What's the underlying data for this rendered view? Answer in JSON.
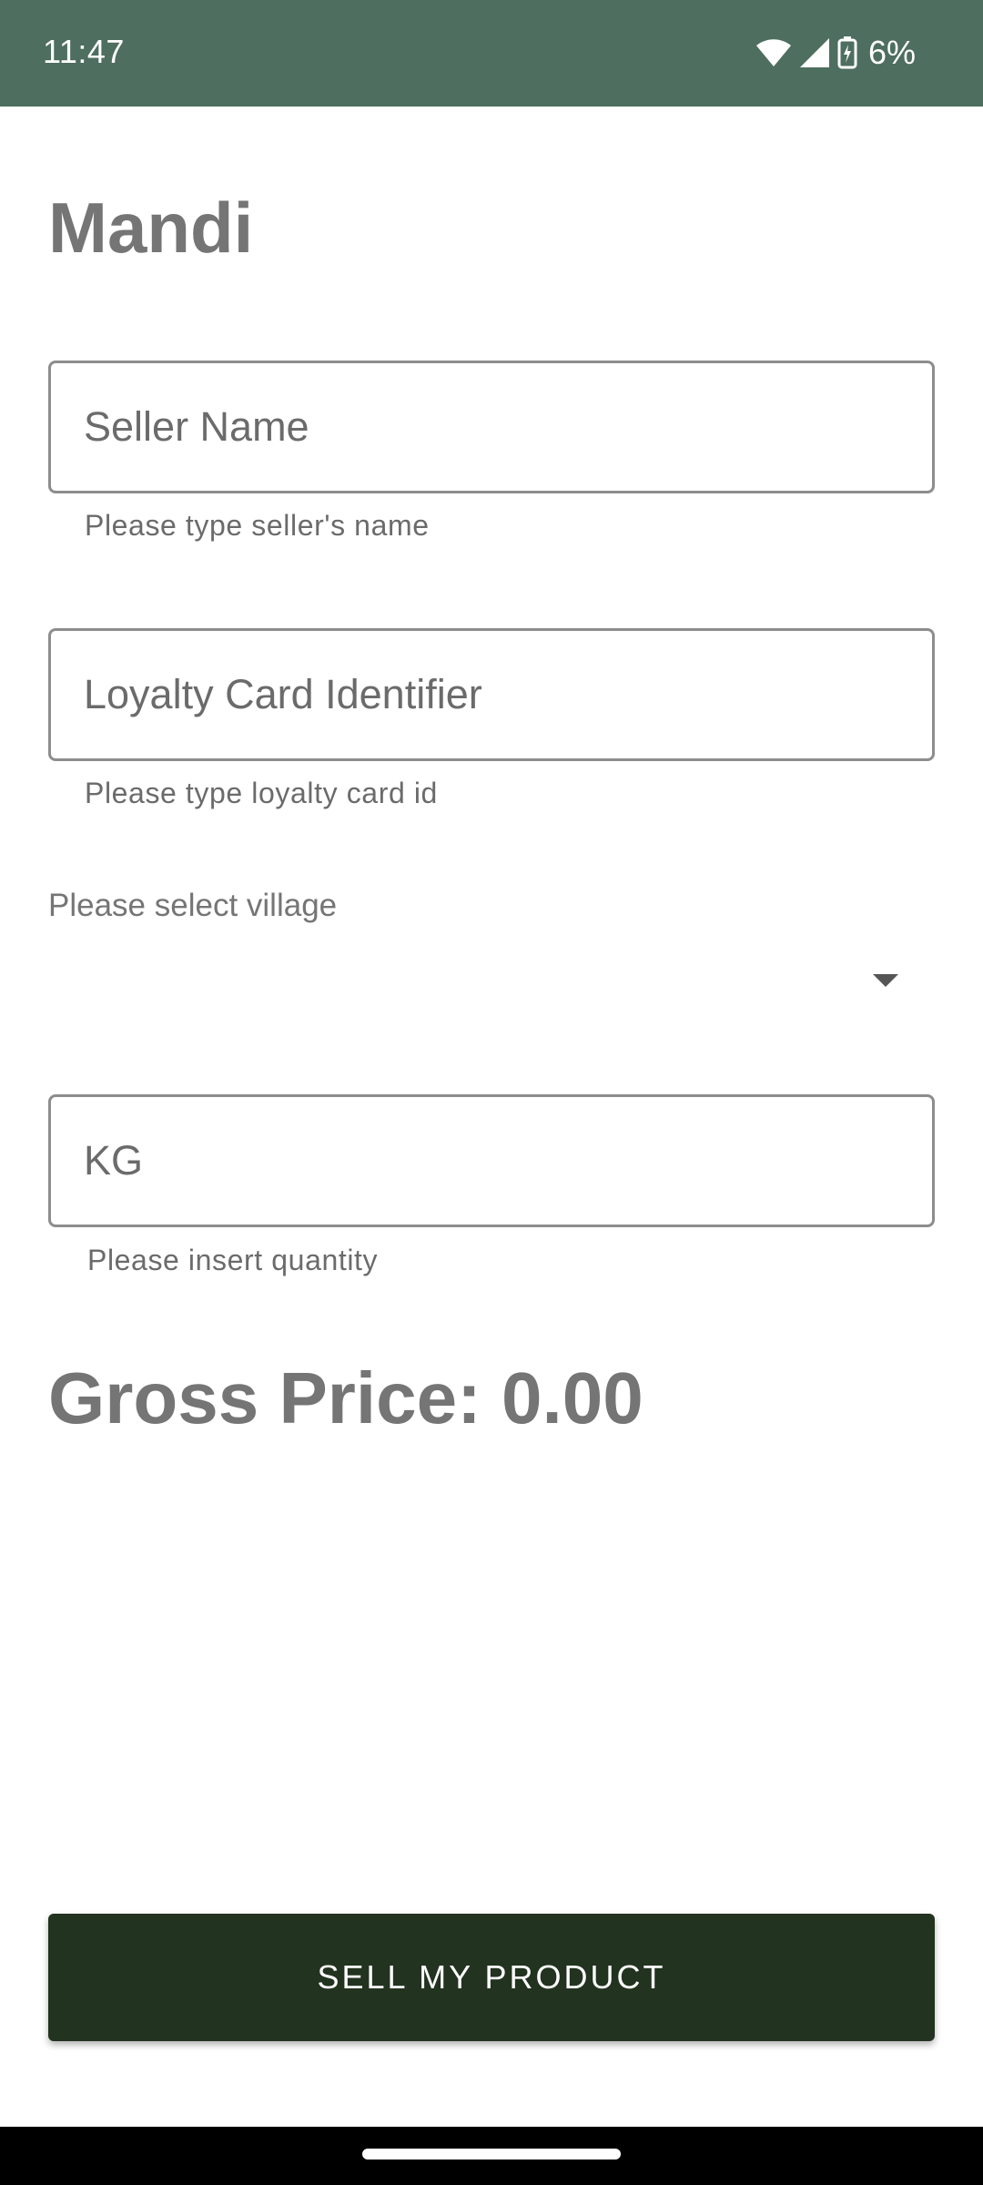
{
  "status_bar": {
    "time": "11:47",
    "battery": "6%",
    "icons": [
      "wifi-icon",
      "signal-icon",
      "battery-charging-icon"
    ],
    "color": "#4e6e5f"
  },
  "app": {
    "title": "Mandi"
  },
  "form": {
    "seller_name": {
      "placeholder": "Seller Name",
      "value": "",
      "helper": "Please type seller's name"
    },
    "loyalty_card": {
      "placeholder": "Loyalty Card Identifier",
      "value": "",
      "helper": "Please type loyalty card id"
    },
    "village": {
      "label": "Please select village",
      "selected": ""
    },
    "quantity": {
      "placeholder": "KG",
      "value": "",
      "helper": "Please insert quantity"
    }
  },
  "gross_price": {
    "label": "Gross Price: ",
    "value": "0.00"
  },
  "actions": {
    "sell_label": "SELL MY PRODUCT",
    "button_color": "#22331f"
  }
}
